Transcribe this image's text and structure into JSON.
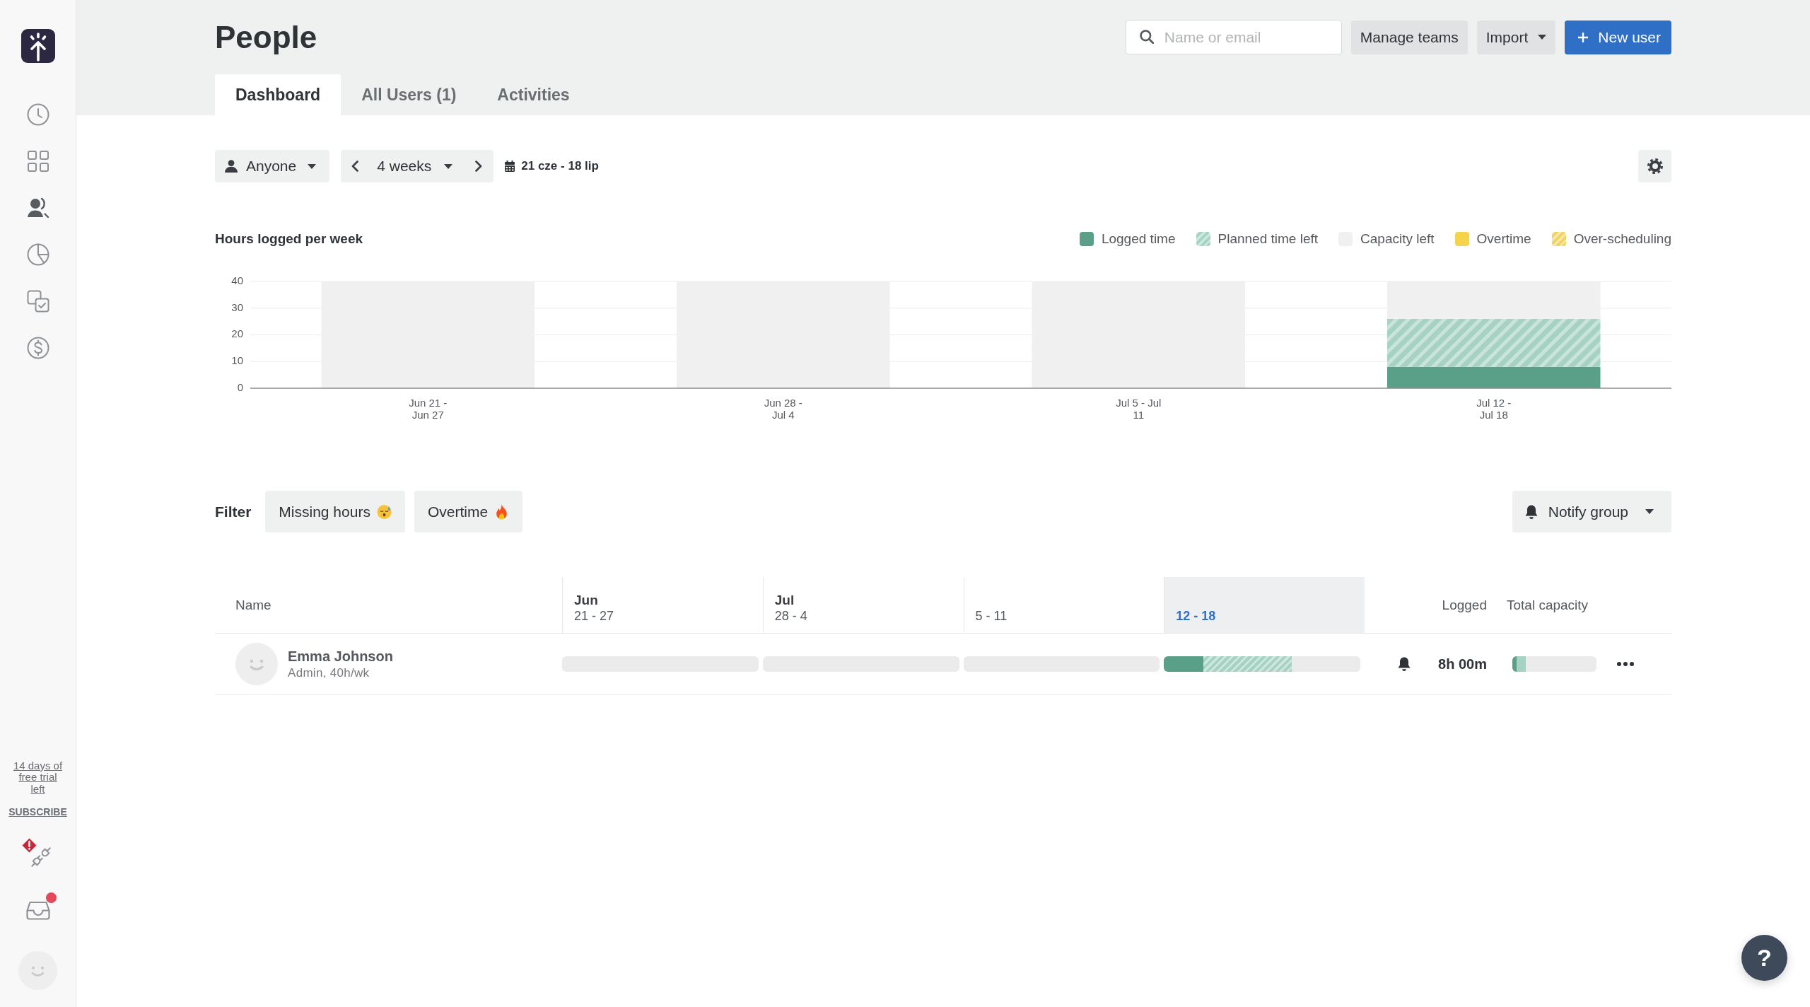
{
  "sidebar": {
    "nav": [
      {
        "kind": "clock",
        "selected": false
      },
      {
        "kind": "grid",
        "selected": false
      },
      {
        "kind": "people",
        "selected": true
      },
      {
        "kind": "pie",
        "selected": false
      },
      {
        "kind": "tasks",
        "selected": false
      },
      {
        "kind": "billing",
        "selected": false
      }
    ],
    "trial": "14 days of free trial left",
    "subscribe": "SUBSCRIBE",
    "integrations": {
      "alert": true
    },
    "inbox": {
      "unread": true
    }
  },
  "header": {
    "title": "People",
    "search": {
      "placeholder": "Name or email"
    },
    "buttons": [
      {
        "kind": "plain",
        "label": "Manage teams"
      },
      {
        "kind": "dropdown",
        "label": "Import"
      },
      {
        "kind": "primary",
        "label": "New user"
      }
    ]
  },
  "tabs": [
    {
      "label": "Dashboard",
      "selected": true
    },
    {
      "label": "All Users (1)",
      "selected": false
    },
    {
      "label": "Activities",
      "selected": false
    }
  ],
  "toolbar": {
    "person_filter": "Anyone",
    "period": "4 weeks",
    "date_range": "21 cze - 18 lip"
  },
  "chart": {
    "chart_data": {
      "type": "bar",
      "title": "Hours logged per week",
      "categories": [
        "Jun 21 - Jun 27",
        "Jun 28 - Jul 4",
        "Jul 5 - Jul 11",
        "Jul 12 - Jul 18"
      ],
      "series": [
        {
          "name": "Logged time",
          "color": "#5a9f88",
          "values": [
            0,
            0,
            0,
            8
          ]
        },
        {
          "name": "Planned time left",
          "color": "#a5d2c3",
          "values": [
            0,
            0,
            0,
            18
          ]
        },
        {
          "name": "Capacity left",
          "color": "#f0f0f0",
          "values": [
            40,
            40,
            40,
            14
          ]
        },
        {
          "name": "Overtime",
          "color": "#f5d44c",
          "values": [
            0,
            0,
            0,
            0
          ]
        },
        {
          "name": "Over-scheduling",
          "color": "#f2d35a",
          "values": [
            0,
            0,
            0,
            0
          ]
        }
      ],
      "ylim": [
        0,
        40
      ],
      "yticks": [
        0,
        10,
        20,
        30,
        40
      ],
      "grid": true,
      "stacked": true
    }
  },
  "filter": {
    "label": "Filter",
    "chips": [
      {
        "kind": "missing_hours",
        "label": "Missing hours",
        "selected": false
      },
      {
        "kind": "overtime",
        "label": "Overtime",
        "selected": false
      }
    ],
    "notify": "Notify group"
  },
  "table": {
    "columns": [
      {
        "kind": "name",
        "label": "Name"
      },
      {
        "kind": "week",
        "month": "Jun",
        "range": "21 - 27",
        "current": false
      },
      {
        "kind": "week",
        "month": "Jul",
        "range": "28 - 4",
        "current": false
      },
      {
        "kind": "week",
        "range": "5 - 11",
        "current": false
      },
      {
        "kind": "week",
        "range": "12 - 18",
        "current": true
      },
      {
        "kind": "logged",
        "label": "Logged"
      },
      {
        "kind": "capacity",
        "label": "Total capacity"
      }
    ],
    "rows": [
      {
        "name": "Emma Johnson",
        "details": "Admin, 40h/wk",
        "weeks": [
          {
            "kind": "empty"
          },
          {
            "kind": "empty"
          },
          {
            "kind": "empty"
          },
          {
            "kind": "hours",
            "logged": {
              "level": 0.2
            },
            "planned": {
              "level": 0.45
            }
          }
        ],
        "logged": "8h 00m",
        "total_capacity": {
          "logged": {
            "level": 0.05
          },
          "planned": {
            "level": 0.11
          }
        }
      }
    ]
  },
  "help": "?"
}
